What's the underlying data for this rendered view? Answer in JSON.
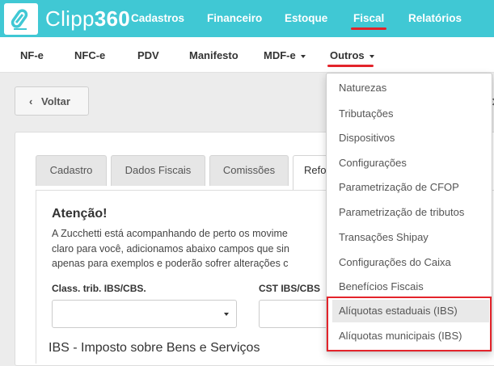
{
  "brand": {
    "name_light": "Clipp",
    "name_bold": "360"
  },
  "topnav": [
    "Cadastros",
    "Financeiro",
    "Estoque",
    "Fiscal",
    "Relatórios"
  ],
  "subnav": [
    "NF-e",
    "NFC-e",
    "PDV",
    "Manifesto",
    "MDF-e",
    "Outros"
  ],
  "back_button": {
    "chevron": "‹",
    "label": "Voltar"
  },
  "tabs": [
    "Cadastro",
    "Dados Fiscais",
    "Comissões",
    "Refo"
  ],
  "notice": {
    "title": "Atenção!",
    "lines": [
      "A Zucchetti está acompanhando de perto os movime",
      "claro para você, adicionamos abaixo campos que sin",
      "apenas para exemplos e poderão sofrer alterações c"
    ]
  },
  "fields": {
    "class_trib_label": "Class. trib. IBS/CBS.",
    "cst_label": "CST IBS/CBS"
  },
  "section_title": "IBS - Imposto sobre Bens e Serviços",
  "dropdown": {
    "items": [
      "Naturezas",
      "Tributações",
      "Dispositivos",
      "Configurações",
      "Parametrização de CFOP",
      "Parametrização de tributos",
      "Transações Shipay",
      "Configurações do Caixa",
      "Benefícios Fiscais",
      "Alíquotas estaduais (IBS)",
      "Alíquotas municipais (IBS)"
    ],
    "hover_item": "Alíquotas estaduais (IBS)"
  },
  "colors": {
    "topbar": "#40c8d4",
    "active_underline": "#e3242b",
    "highlight_box": "#e3242b"
  },
  "icons": {
    "logo": "clipp-logo-icon",
    "back": "chevron-left-icon",
    "select_caret": "caret-down-icon"
  }
}
